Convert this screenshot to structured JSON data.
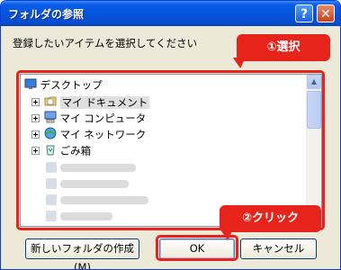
{
  "window": {
    "title": "フォルダの参照",
    "help_glyph": "?",
    "close_glyph": "✕"
  },
  "prompt": "登録したいアイテムを選択してください",
  "callouts": {
    "step1": "①選択",
    "step2": "②クリック"
  },
  "tree": {
    "root": "デスクトップ",
    "items": [
      {
        "label": "マイ ドキュメント",
        "icon": "documents-folder-icon",
        "selected": true
      },
      {
        "label": "マイ コンピュータ",
        "icon": "computer-icon",
        "selected": false
      },
      {
        "label": "マイ ネットワーク",
        "icon": "network-icon",
        "selected": false
      },
      {
        "label": "ごみ箱",
        "icon": "recycle-bin-icon",
        "selected": false
      }
    ]
  },
  "buttons": {
    "new_folder": "新しいフォルダの作成(M)",
    "ok": "OK",
    "cancel": "キャンセル"
  },
  "colors": {
    "accent": "#e6241b",
    "titlebar": "#0453d9",
    "dialog_bg": "#ece9d8"
  }
}
